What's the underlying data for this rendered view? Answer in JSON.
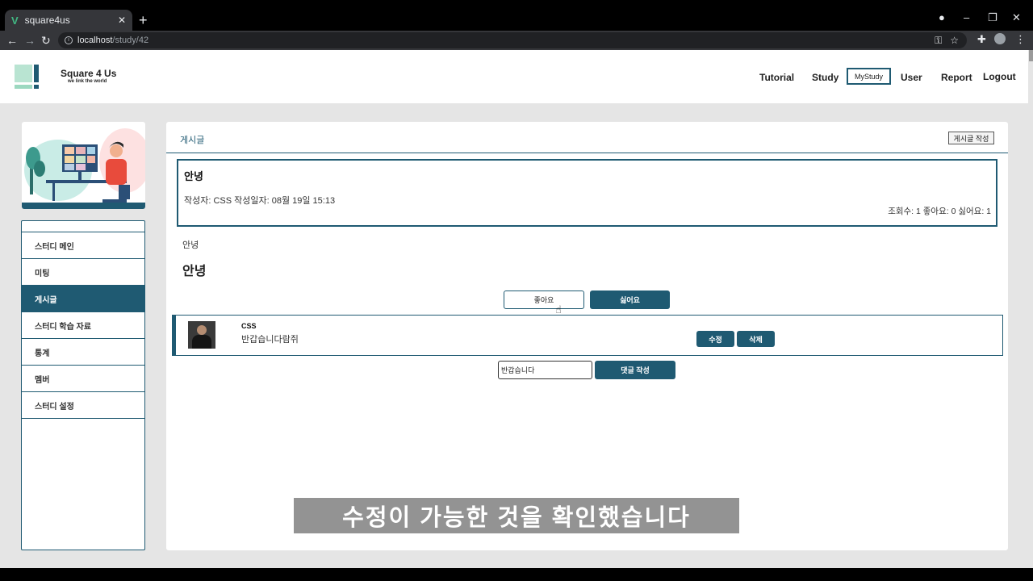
{
  "browser": {
    "tab_title": "square4us",
    "url_host": "localhost",
    "url_path": "/study/42"
  },
  "header": {
    "brand": "Square 4 Us",
    "slogan": "we link the world",
    "nav": [
      "Tutorial",
      "Study",
      "MyStudy",
      "User",
      "Report",
      "Logout"
    ]
  },
  "sidebar": {
    "items": [
      {
        "label": "스터디 메인"
      },
      {
        "label": "미팅"
      },
      {
        "label": "게시글",
        "active": true
      },
      {
        "label": "스터디 학습 자료"
      },
      {
        "label": "통계"
      },
      {
        "label": "멤버"
      },
      {
        "label": "스터디 설정"
      }
    ]
  },
  "main": {
    "title": "게시글",
    "write_button": "게시글 작성",
    "post": {
      "title": "안녕",
      "meta": "작성자: CSS 작성일자: 08월 19일 15:13",
      "stats": "조회수: 1 좋아요: 0 싫어요: 1"
    },
    "content_line1": "안녕",
    "content_line2": "안녕",
    "like_button": "좋아요",
    "dislike_button": "싫어요",
    "comment": {
      "author": "CSS",
      "text": "반갑습니다람쥐",
      "edit_button": "수정",
      "delete_button": "삭제"
    },
    "comment_input_value": "반갑습니다",
    "comment_submit": "댓글 작성"
  },
  "caption": "수정이 가능한 것을 확인했습니다",
  "colors": {
    "accent": "#1f5a72",
    "logo_light": "#b9e4d2",
    "page_bg": "#e5e5e5"
  }
}
